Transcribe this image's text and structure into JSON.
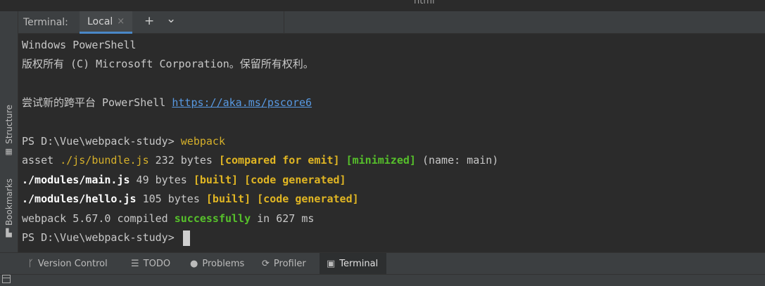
{
  "window": {
    "title": "html"
  },
  "side_tabs": {
    "structure": {
      "label": "Structure",
      "icon": "structure-icon"
    },
    "bookmarks": {
      "label": "Bookmarks",
      "icon": "bookmark-icon"
    }
  },
  "terminal_header": {
    "label": "Terminal:",
    "tab": {
      "label": "Local",
      "close": "×"
    },
    "new_tab": "+",
    "dropdown": "⌄"
  },
  "terminal": {
    "l1": "Windows PowerShell",
    "l2": "版权所有 (C) Microsoft Corporation。保留所有权利。",
    "l3_text": "尝试新的跨平台 PowerShell ",
    "l3_link": "https://aka.ms/pscore6",
    "prompt": "PS D:\\Vue\\webpack-study> ",
    "command": "webpack",
    "asset": {
      "a": "asset ",
      "file": "./js/bundle.js",
      "size": " 232 bytes ",
      "flag1": "[compared for emit]",
      "gap": " ",
      "flag2": "[minimized]",
      "tail": " (name: main)"
    },
    "mod1": {
      "file": "./modules/main.js",
      "size": " 49 bytes ",
      "flag1": "[built]",
      "gap": " ",
      "flag2": "[code generated]"
    },
    "mod2": {
      "file": "./modules/hello.js",
      "size": " 105 bytes ",
      "flag1": "[built]",
      "gap": " ",
      "flag2": "[code generated]"
    },
    "result": {
      "a": "webpack 5.67.0 compiled ",
      "ok": "successfully",
      "b": " in 627 ms"
    },
    "prompt2": "PS D:\\Vue\\webpack-study> "
  },
  "bottom_tabs": [
    {
      "label": "Version Control",
      "icon": "branch-icon"
    },
    {
      "label": "TODO",
      "icon": "list-icon"
    },
    {
      "label": "Problems",
      "icon": "warning-icon"
    },
    {
      "label": "Profiler",
      "icon": "profiler-icon"
    },
    {
      "label": "Terminal",
      "icon": "terminal-icon",
      "active": true
    }
  ],
  "colors": {
    "accent": "#4a88c7",
    "yellow": "#d6b02a",
    "green": "#5bbf2e",
    "link": "#5899e2",
    "background": "#2b2b2b"
  }
}
